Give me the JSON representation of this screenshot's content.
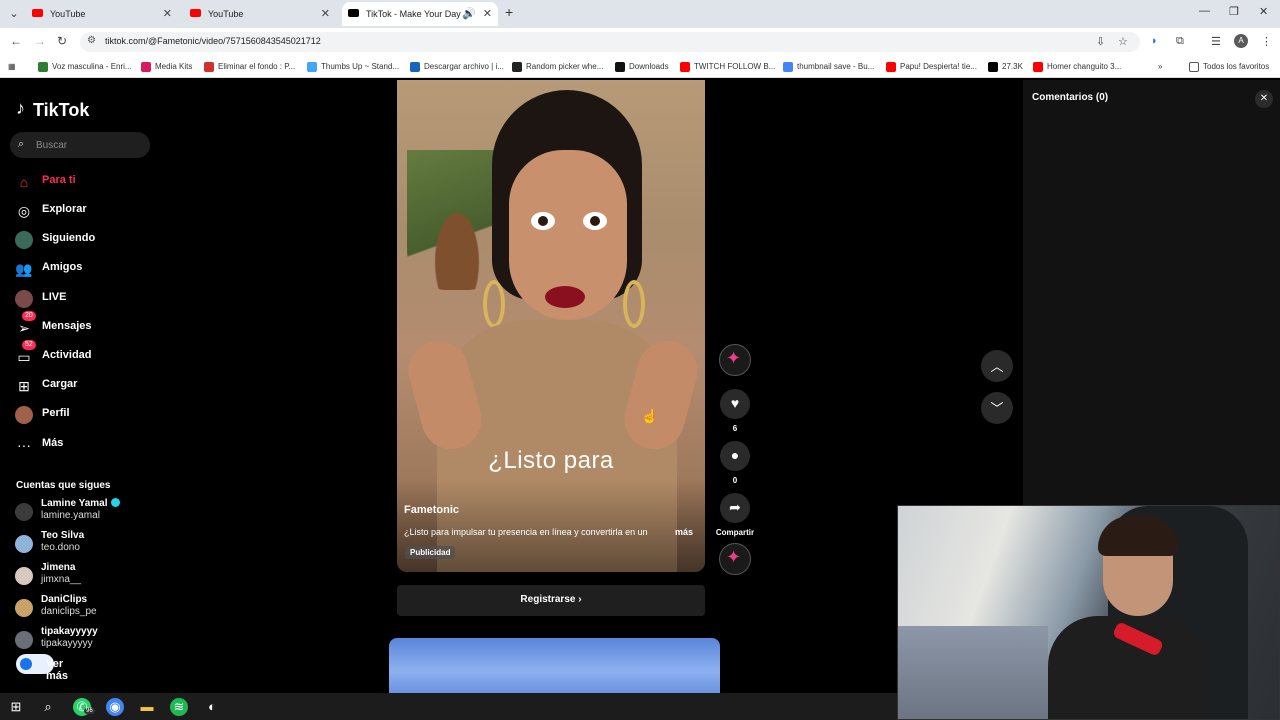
{
  "browser": {
    "tabs": [
      {
        "title": "YouTube",
        "color": "#ff0000"
      },
      {
        "title": "YouTube",
        "color": "#ff0000"
      },
      {
        "title": "TikTok - Make Your Day",
        "color": "#000000"
      }
    ],
    "url": "tiktok.com/@Fametonic/video/7571560843545021712",
    "profile_initial": "A",
    "bookmarks": [
      {
        "label": "Voz masculina - Enri...",
        "color": "#2e7d32"
      },
      {
        "label": "Media Kits",
        "color": "#d81b60"
      },
      {
        "label": "Eliminar el fondo : P...",
        "color": "#d32f2f"
      },
      {
        "label": "Thumbs Up ~ Stand...",
        "color": "#42a5f5"
      },
      {
        "label": "Descargar archivo | i...",
        "color": "#1565c0"
      },
      {
        "label": "Random picker whe...",
        "color": "#222222"
      },
      {
        "label": "Downloads",
        "color": "#111111"
      },
      {
        "label": "TWITCH FOLLOW B...",
        "color": "#ff0000"
      },
      {
        "label": "thumbnail save - Bu...",
        "color": "#4285f4"
      },
      {
        "label": "Papu! Despierta! tie...",
        "color": "#ff0000"
      },
      {
        "label": "27.3K",
        "color": "#000000"
      },
      {
        "label": "Homer changuito 3...",
        "color": "#ff0000"
      }
    ],
    "all_bookmarks": "Todos los favoritos"
  },
  "sidebar": {
    "brand": "TikTok",
    "search_placeholder": "Buscar",
    "nav": [
      {
        "label": "Para ti",
        "icon": "home-icon"
      },
      {
        "label": "Explorar",
        "icon": "compass-icon"
      },
      {
        "label": "Siguiendo",
        "icon": "following-icon"
      },
      {
        "label": "Amigos",
        "icon": "friends-icon"
      },
      {
        "label": "LIVE",
        "icon": "live-icon"
      },
      {
        "label": "Mensajes",
        "icon": "messages-icon",
        "badge": "20"
      },
      {
        "label": "Actividad",
        "icon": "activity-icon",
        "badge": "52"
      },
      {
        "label": "Cargar",
        "icon": "upload-icon"
      },
      {
        "label": "Perfil",
        "icon": "profile-icon"
      },
      {
        "label": "Más",
        "icon": "more-icon"
      }
    ],
    "following_title": "Cuentas que sigues",
    "following": [
      {
        "name": "Lamine Yamal",
        "handle": "lamine.yamal",
        "verified": true,
        "color": "#3b3b3b"
      },
      {
        "name": "Teo Silva",
        "handle": "teo.dono",
        "color": "#8fb3d9"
      },
      {
        "name": "Jimena",
        "handle": "jimxna__",
        "color": "#d8c9c0"
      },
      {
        "name": "DaniClips",
        "handle": "daniclips_pe",
        "color": "#c9a26a"
      },
      {
        "name": "tipakayyyyy",
        "handle": "tipakayyyyy",
        "color": "#6a6f77"
      }
    ],
    "see_more": "Ver más"
  },
  "video": {
    "caption_overlay": "¿Listo para",
    "author": "Fametonic",
    "description": "¿Listo para impulsar tu presencia en línea y convertirla en un",
    "more_label": "más",
    "ad_label": "Publicidad",
    "cta_label": "Registrarse",
    "likes": "6",
    "comments": "0",
    "share_label": "Compartir"
  },
  "comments_panel": {
    "title": "Comentarios (0)"
  },
  "taskbar": {
    "whatsapp_badge": "96"
  }
}
